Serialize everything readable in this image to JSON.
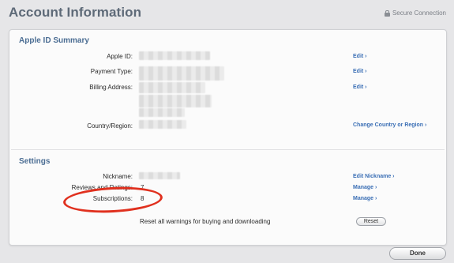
{
  "header": {
    "title": "Account Information",
    "secure_label": "Secure Connection"
  },
  "apple_id_summary": {
    "title": "Apple ID Summary",
    "rows": {
      "apple_id": {
        "label": "Apple ID:",
        "action": "Edit ›"
      },
      "payment_type": {
        "label": "Payment Type:",
        "action": "Edit ›"
      },
      "billing_address": {
        "label": "Billing Address:",
        "action": "Edit ›"
      },
      "country_region": {
        "label": "Country/Region:",
        "action": "Change Country or Region ›"
      }
    }
  },
  "settings": {
    "title": "Settings",
    "nickname": {
      "label": "Nickname:",
      "action": "Edit Nickname ›"
    },
    "reviews_ratings": {
      "label": "Reviews and Ratings:",
      "value": "7",
      "action": "Manage ›"
    },
    "subscriptions": {
      "label": "Subscriptions:",
      "value": "8",
      "action": "Manage ›"
    },
    "reset_warnings": {
      "text": "Reset all warnings for buying and downloading",
      "button": "Reset"
    }
  },
  "footer": {
    "done_label": "Done"
  },
  "colors": {
    "annotation_circle": "#e0301e",
    "link": "#3b6fb5",
    "section_title": "#4b6d93"
  }
}
